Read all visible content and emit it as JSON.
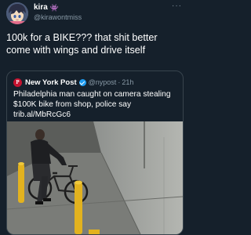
{
  "author": {
    "display_name": "kira",
    "name_emoji": "👾",
    "handle": "@kirawontmiss",
    "avatar_icon": "anime-avatar"
  },
  "more_icon": "more-horizontal-icon",
  "tweet": {
    "text": "100k for a BIKE??? that shit better come with wings and drive itself"
  },
  "quote": {
    "source_name": "New York Post",
    "logo_letter": "P",
    "verified": true,
    "handle": "@nypost",
    "separator": "·",
    "time": "21h",
    "text": "Philadelphia man caught on camera stealing $100K bike from shop, police say trib.al/MbRcGc6",
    "image_description_icon": "surveillance-photo"
  },
  "colors": {
    "background": "#15202b",
    "text": "#ffffff",
    "muted": "#8899a6",
    "border": "#38444d",
    "nypost_red": "#c4122f",
    "verified_blue": "#1d9bf0",
    "bollard_yellow": "#e2b21f"
  }
}
